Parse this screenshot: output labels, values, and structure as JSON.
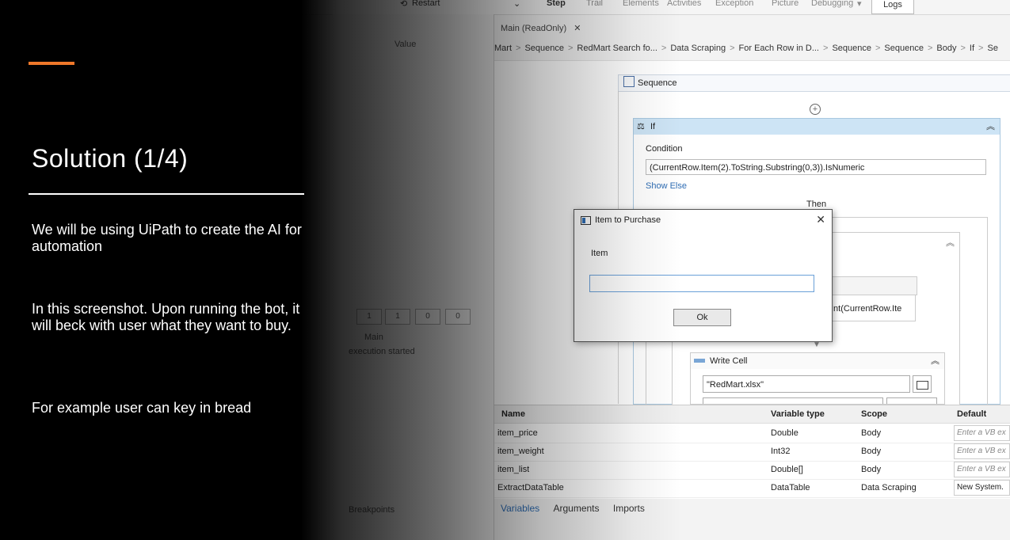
{
  "slide": {
    "title": "Solution (1/4)",
    "paragraphs": [
      "We will be using UiPath to create the AI for automation",
      "In this screenshot. Upon running the bot, it will beck with user what they want to buy.",
      "For example user can key in bread"
    ],
    "accent_color": "#f0782a"
  },
  "ribbon": {
    "items": [
      "Restart",
      "Step",
      "Trail",
      "Elements",
      "Activities",
      "Exception",
      "Picture",
      "Debugging",
      "Logs"
    ]
  },
  "left_panel": {
    "value_header": "Value",
    "log_lines": [
      "Main",
      "execution started"
    ],
    "counters": [
      "1",
      "1",
      "0",
      "0"
    ],
    "breakpoints_label": "Breakpoints"
  },
  "document": {
    "tab": "Main (ReadOnly)",
    "breadcrumb": [
      "Mart",
      "Sequence",
      "RedMart Search fo...",
      "Data Scraping",
      "For Each Row in D...",
      "Sequence",
      "Sequence",
      "Body",
      "If",
      "Se"
    ]
  },
  "designer": {
    "sequence_label": "Sequence",
    "if_label": "If",
    "condition_label": "Condition",
    "condition_expression": "(CurrentRow.Item(2).ToString.Substring(0,3)).IsNumeric",
    "show_else": "Show Else",
    "then_label": "Then",
    "assign_fragment": "Int(CurrentRow.Ite",
    "write_cell_label": "Write Cell",
    "write_cell_file": "\"RedMart.xlsx\""
  },
  "dialog": {
    "title": "Item to Purchase",
    "label": "Item",
    "input_value": "",
    "ok_label": "Ok"
  },
  "variables": {
    "headers": [
      "Name",
      "Variable type",
      "Scope",
      "Default"
    ],
    "rows": [
      {
        "name": "item_price",
        "type": "Double",
        "scope": "Body",
        "default": "Enter a VB ex"
      },
      {
        "name": "item_weight",
        "type": "Int32",
        "scope": "Body",
        "default": "Enter a VB ex"
      },
      {
        "name": "item_list",
        "type": "Double[]",
        "scope": "Body",
        "default": "Enter a VB ex"
      },
      {
        "name": "ExtractDataTable",
        "type": "DataTable",
        "scope": "Data Scraping",
        "default": "New System."
      }
    ],
    "tabs": [
      "Variables",
      "Arguments",
      "Imports"
    ]
  }
}
